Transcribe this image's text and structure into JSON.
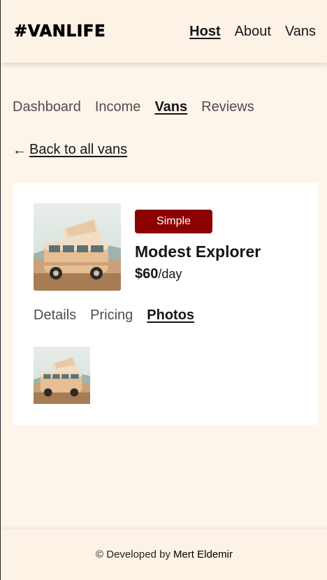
{
  "header": {
    "logo": "#VANLIFE",
    "nav": [
      {
        "label": "Host",
        "active": true
      },
      {
        "label": "About",
        "active": false
      },
      {
        "label": "Vans",
        "active": false
      }
    ]
  },
  "host_nav": [
    {
      "label": "Dashboard",
      "active": false
    },
    {
      "label": "Income",
      "active": false
    },
    {
      "label": "Vans",
      "active": true
    },
    {
      "label": "Reviews",
      "active": false
    }
  ],
  "back_link": {
    "arrow": "←",
    "label": "Back to all vans"
  },
  "van": {
    "type": "Simple",
    "type_color": "#8b0000",
    "name": "Modest Explorer",
    "price": "$60",
    "price_unit": "/day"
  },
  "detail_tabs": [
    {
      "label": "Details",
      "active": false
    },
    {
      "label": "Pricing",
      "active": false
    },
    {
      "label": "Photos",
      "active": true
    }
  ],
  "footer": {
    "prefix": "© Developed by",
    "author": "Mert Eldemir"
  }
}
